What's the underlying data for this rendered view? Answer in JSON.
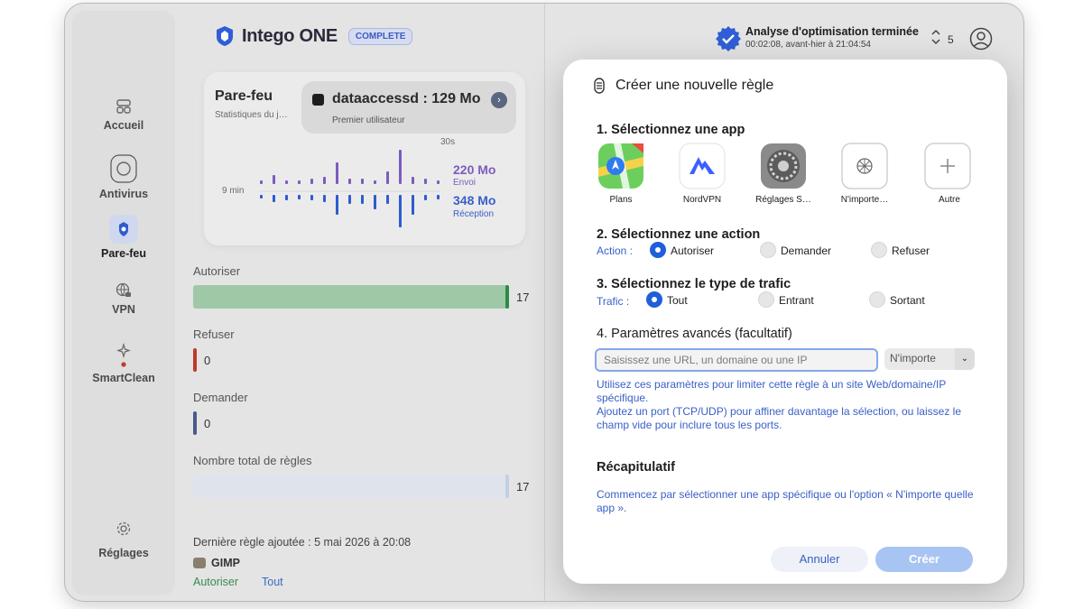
{
  "brand": {
    "name": "Intego ONE",
    "badge": "COMPLETE"
  },
  "status": {
    "scan_title": "Analyse d'optimisation terminée",
    "scan_time": "00:02:08, avant-hier à 21:04:54",
    "count": "5"
  },
  "sidebar": {
    "items": [
      {
        "label": "Accueil",
        "icon": "home-icon"
      },
      {
        "label": "Antivirus",
        "icon": "antivirus-icon"
      },
      {
        "label": "Pare-feu",
        "icon": "firewall-icon",
        "active": true
      },
      {
        "label": "VPN",
        "icon": "vpn-icon"
      },
      {
        "label": "SmartClean",
        "icon": "smartclean-icon"
      }
    ],
    "settings_label": "Réglages"
  },
  "firewall": {
    "title": "Pare-feu",
    "subtitle": "Statistiques du j…",
    "pill_title": "dataaccessd : 129 Mo",
    "pill_sub": "Premier utilisateur",
    "label_30s": "30s",
    "label_9min": "9 min",
    "sent_value": "220 Mo",
    "sent_label": "Envoi",
    "recv_value": "348 Mo",
    "recv_label": "Réception"
  },
  "stats": [
    {
      "label": "Autoriser",
      "value": "17",
      "fraction": 1.0,
      "color": "#2f8a4a"
    },
    {
      "label": "Refuser",
      "value": "0",
      "fraction": 0.0,
      "color": "#c0392b"
    },
    {
      "label": "Demander",
      "value": "0",
      "fraction": 0.0,
      "color": "#4a5a8a"
    },
    {
      "label": "Nombre total de règles",
      "value": "17",
      "fraction": 1.0,
      "color": "#9fb5e0"
    }
  ],
  "last_rule": {
    "text": "Dernière règle ajoutée : 5 mai 2026 à 20:08",
    "app": "GIMP",
    "action": "Autoriser",
    "traffic": "Tout"
  },
  "dialog": {
    "title": "Créer une nouvelle règle",
    "step1": "1. Sélectionnez une app",
    "apps": [
      {
        "name": "Plans",
        "icon": "maps-icon"
      },
      {
        "name": "NordVPN",
        "icon": "nordvpn-icon"
      },
      {
        "name": "Réglages S…",
        "icon": "system-settings-icon"
      },
      {
        "name": "N'importe…",
        "icon": "any-app-icon"
      },
      {
        "name": "Autre",
        "icon": "plus-icon"
      }
    ],
    "step2": "2. Sélectionnez une action",
    "action_label": "Action :",
    "actions": [
      "Autoriser",
      "Demander",
      "Refuser"
    ],
    "action_selected": "Autoriser",
    "step3": "3. Sélectionnez le type de trafic",
    "traffic_label": "Trafic :",
    "traffics": [
      "Tout",
      "Entrant",
      "Sortant"
    ],
    "traffic_selected": "Tout",
    "step4": "4. Paramètres avancés (facultatif)",
    "url_placeholder": "Saisissez une URL, un domaine ou une IP",
    "port_value": "N'importe",
    "help1": "Utilisez ces paramètres pour limiter cette règle à un site Web/domaine/IP spécifique.",
    "help2": "Ajoutez un port (TCP/UDP) pour affiner davantage la sélection, ou laissez le champ vide pour inclure tous les ports.",
    "summary_title": "Récapitulatif",
    "summary_text": "Commencez par sélectionner une app spécifique ou l'option « N'importe quelle app ».",
    "cancel": "Annuler",
    "create": "Créer"
  }
}
